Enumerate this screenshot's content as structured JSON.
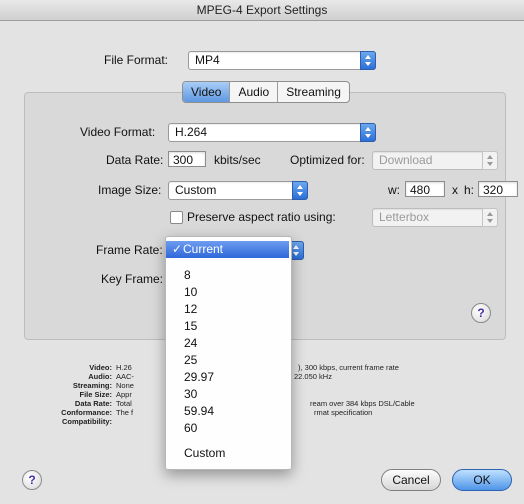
{
  "window": {
    "title": "MPEG-4 Export Settings"
  },
  "file_format": {
    "label": "File Format:",
    "value": "MP4"
  },
  "tabs": [
    {
      "label": "Video",
      "active": true
    },
    {
      "label": "Audio",
      "active": false
    },
    {
      "label": "Streaming",
      "active": false
    }
  ],
  "video": {
    "format_label": "Video Format:",
    "format_value": "H.264",
    "data_rate_label": "Data Rate:",
    "data_rate_value": "300",
    "data_rate_unit": "kbits/sec",
    "optimized_label": "Optimized for:",
    "optimized_value": "Download",
    "image_size_label": "Image Size:",
    "image_size_value": "Custom",
    "w_label": "w:",
    "w_value": "480",
    "x_sep": "x",
    "h_label": "h:",
    "h_value": "320",
    "preserve_label": "Preserve aspect ratio using:",
    "preserve_value": "Letterbox",
    "frame_rate_label": "Frame Rate:",
    "frame_rate_value": "Current",
    "key_frame_label": "Key Frame:"
  },
  "frame_rate_menu": {
    "selected": "Current",
    "items": [
      "8",
      "10",
      "12",
      "15",
      "24",
      "25",
      "29.97",
      "30",
      "59.94",
      "60",
      "Custom"
    ]
  },
  "summary": [
    {
      "key": "Video:",
      "value": "H.26",
      "value2": "), 300 kbps, current frame rate"
    },
    {
      "key": "Audio:",
      "value": "AAC-",
      "value2": "22.050 kHz"
    },
    {
      "key": "Streaming:",
      "value": "None",
      "value2": ""
    },
    {
      "key": "File Size:",
      "value": "Appr",
      "value2": ""
    },
    {
      "key": "Data Rate:",
      "value": "Total",
      "value2": "ream over 384 kbps DSL/Cable"
    },
    {
      "key": "Conformance:",
      "value": "The f",
      "value2": "rmat specification"
    },
    {
      "key": "Compatibility:",
      "value": "",
      "value2": ""
    }
  ],
  "buttons": {
    "help": "?",
    "cancel": "Cancel",
    "ok": "OK"
  },
  "colors": {
    "accent": "#3b78e0",
    "window_bg": "#e3e3e3"
  }
}
